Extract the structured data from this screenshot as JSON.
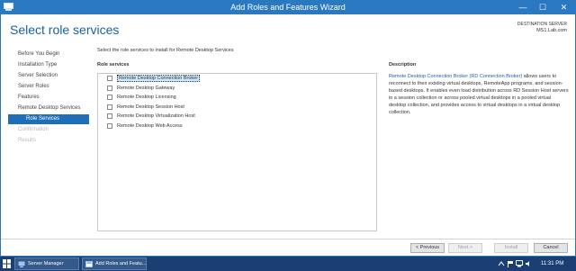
{
  "window": {
    "title": "Add Roles and Features Wizard",
    "minimize": "—",
    "maximize": "☐",
    "close": "✕"
  },
  "header": {
    "page_title": "Select role services",
    "destination_label": "DESTINATION SERVER",
    "destination_server": "MS1.Lab.com"
  },
  "nav": {
    "items": [
      {
        "label": "Before You Begin"
      },
      {
        "label": "Installation Type"
      },
      {
        "label": "Server Selection"
      },
      {
        "label": "Server Roles"
      },
      {
        "label": "Features"
      },
      {
        "label": "Remote Desktop Services"
      },
      {
        "label": "Role Services"
      },
      {
        "label": "Confirmation"
      },
      {
        "label": "Results"
      }
    ]
  },
  "main": {
    "instruction": "Select the role services to install for Remote Desktop Services",
    "role_services_header": "Role services",
    "description_header": "Description",
    "role_services": [
      {
        "label": "Remote Desktop Connection Broker",
        "checked": false
      },
      {
        "label": "Remote Desktop Gateway",
        "checked": false
      },
      {
        "label": "Remote Desktop Licensing",
        "checked": false
      },
      {
        "label": "Remote Desktop Session Host",
        "checked": false
      },
      {
        "label": "Remote Desktop Virtualization Host",
        "checked": false
      },
      {
        "label": "Remote Desktop Web Access",
        "checked": false
      }
    ],
    "description_link": "Remote Desktop Connection Broker (RD Connection Broker)",
    "description_text": " allows users to reconnect to their existing virtual desktops, RemoteApp programs, and session-based desktops. It enables even load distribution across RD Session Host servers in a session collection or across pooled virtual desktops in a pooled virtual desktop collection, and provides access to virtual desktops in a virtual desktop collection."
  },
  "footer": {
    "previous": "< Previous",
    "next": "Next >",
    "install": "Install",
    "cancel": "Cancel"
  },
  "taskbar": {
    "items": [
      {
        "label": "Server Manager"
      },
      {
        "label": "Add Roles and Featu..."
      }
    ],
    "time": "11:31 PM"
  },
  "colors": {
    "accent": "#1f6fb8",
    "titlebar": "#2b78c2",
    "taskbar": "#1b3f73"
  }
}
